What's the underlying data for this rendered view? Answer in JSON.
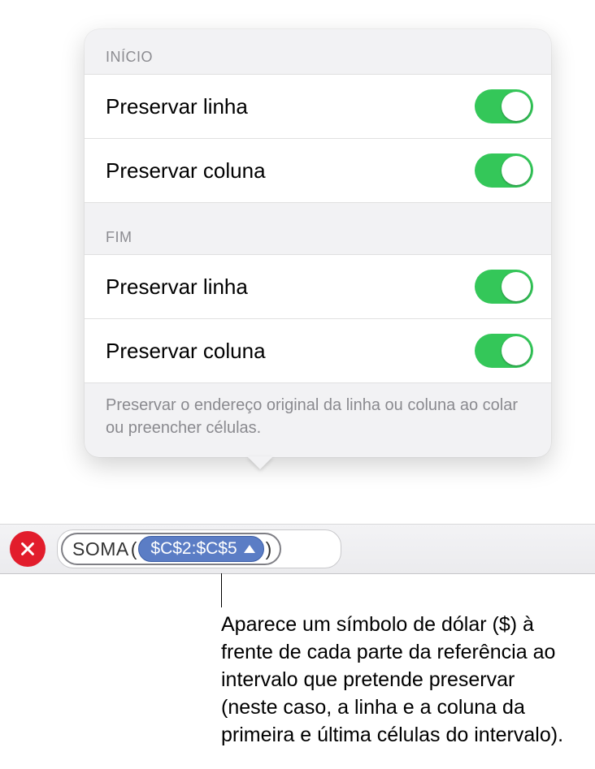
{
  "popover": {
    "section1_title": "INÍCIO",
    "section2_title": "FIM",
    "items": {
      "start_row": "Preservar linha",
      "start_col": "Preservar coluna",
      "end_row": "Preservar linha",
      "end_col": "Preservar coluna"
    },
    "hint": "Preservar o endereço original da linha ou coluna ao colar ou preencher células."
  },
  "formula": {
    "function_name": "SOMA",
    "lparen": "(",
    "rparen": ")",
    "range_ref": "$C$2:$C$5"
  },
  "callout": "Aparece um símbolo de dólar ($) à frente de cada parte da referência ao intervalo que pretende preservar (neste caso, a linha e a coluna da primeira e última células do intervalo)."
}
